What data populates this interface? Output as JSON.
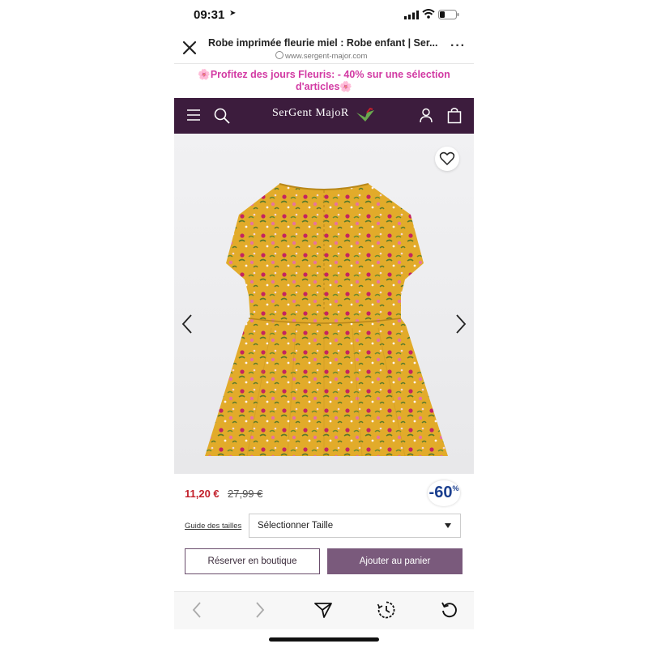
{
  "status_bar": {
    "time": "09:31"
  },
  "browser": {
    "page_title": "Robe imprimée fleurie miel : Robe enfant | Ser...",
    "domain": "www.sergent-major.com"
  },
  "promo": {
    "line1": "🌸Profitez des jours Fleuris: - 40% sur une sélection",
    "line2": "d'articles🌸"
  },
  "site": {
    "logo_text": "SerGent MajoR",
    "header_color": "#3c1c3d"
  },
  "product": {
    "price_now": "11,20 €",
    "price_old": "27,99 €",
    "discount": "-60",
    "discount_unit": "%",
    "size_guide_label": "Guide des tailles",
    "size_select_value": "Sélectionner Taille",
    "reserve_label": "Réserver en boutique",
    "add_to_cart_label": "Ajouter au panier",
    "image_semantic": "floral-yellow-dress"
  },
  "colors": {
    "accent": "#7a5a7c",
    "price": "#c2202b",
    "promo": "#d23aa3",
    "discount": "#1b3f8f",
    "dress": "#e2ab2a"
  },
  "icons": {
    "menu": "hamburger-icon",
    "search": "search-icon",
    "account": "user-icon",
    "bag": "shopping-bag-icon",
    "favorite": "heart-icon",
    "prev": "chevron-left-icon",
    "next": "chevron-right-icon",
    "close": "close-icon",
    "more": "more-icon",
    "toolbar": [
      "back-icon",
      "forward-icon",
      "share-icon",
      "history-icon",
      "reload-icon"
    ]
  }
}
